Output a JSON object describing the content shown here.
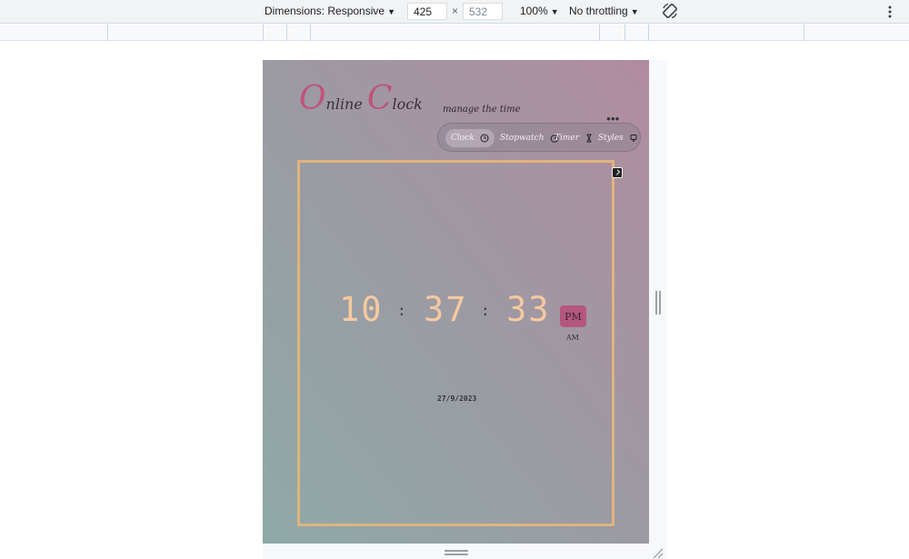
{
  "devtools": {
    "dimensions_label": "Dimensions: Responsive",
    "width_value": "425",
    "height_value": "532",
    "times_symbol": "×",
    "zoom": "100%",
    "throttling": "No throttling"
  },
  "app": {
    "logo": {
      "first_initial": "O",
      "first_rest": "nline",
      "second_initial": "C",
      "second_rest": "lock"
    },
    "tagline": "manage the time",
    "menu_dots": "●●●",
    "nav": [
      {
        "label": "Clock",
        "icon": "clock-icon"
      },
      {
        "label": "Stopwatch",
        "icon": "stopwatch-icon"
      },
      {
        "label": "Timer",
        "icon": "hourglass-icon"
      },
      {
        "label": "Styles",
        "icon": "palette-icon"
      }
    ],
    "clock": {
      "hours": "10",
      "minutes": "37",
      "seconds": "33",
      "separator": ":",
      "meridiem_active": "PM",
      "meridiem_inactive": "AM",
      "date": "27/9/2023"
    }
  },
  "colors": {
    "accent": "#c0527a",
    "digit": "#f6c9a0",
    "frame": "#e0b47d",
    "badge": "#b4577f"
  }
}
